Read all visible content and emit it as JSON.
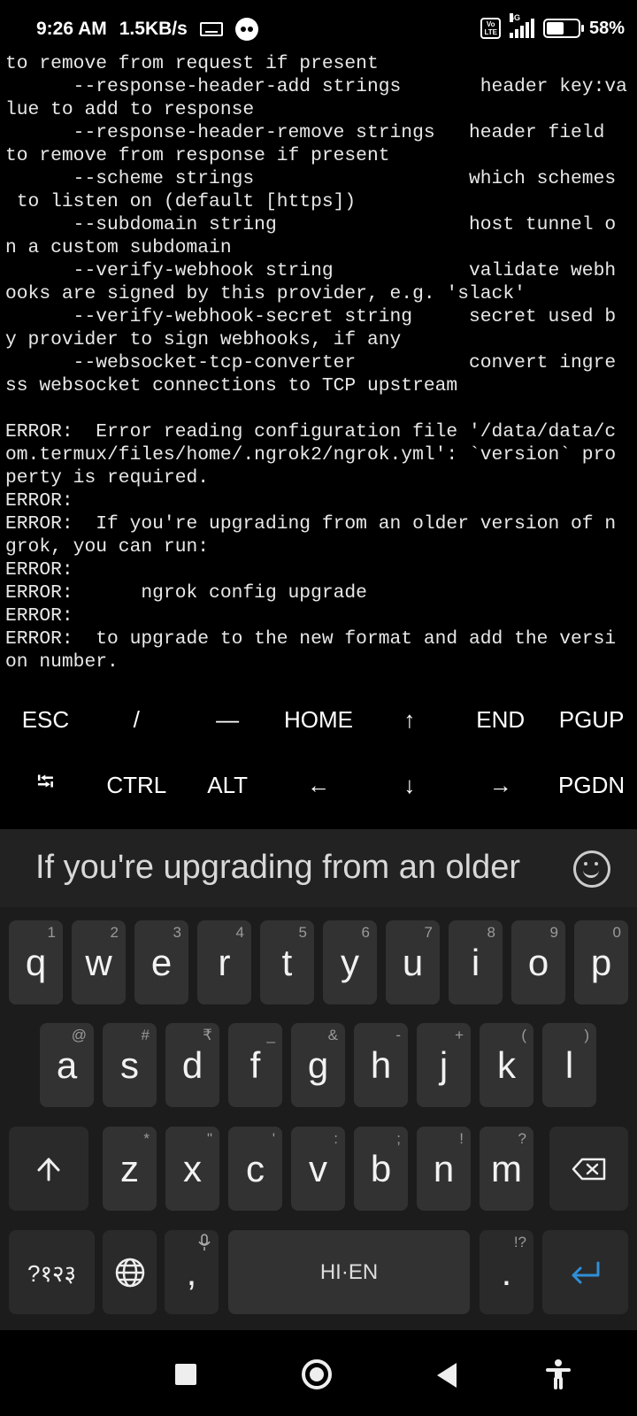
{
  "status_bar": {
    "time": "9:26 AM",
    "net_speed": "1.5KB/s",
    "volte": "Vo\nLTE",
    "network": "4G",
    "battery_percent": "58%",
    "battery_level": 0.58,
    "icons": [
      "keyboard-icon",
      "bubbles-icon",
      "volte-icon",
      "signal-icon",
      "battery-icon"
    ]
  },
  "terminal": {
    "lines": [
      "to remove from request if present",
      "      --response-header-add strings       header key:va",
      "lue to add to response",
      "      --response-header-remove strings   header field",
      "to remove from response if present",
      "      --scheme strings                   which schemes",
      " to listen on (default [https])",
      "      --subdomain string                 host tunnel o",
      "n a custom subdomain",
      "      --verify-webhook string            validate webh",
      "ooks are signed by this provider, e.g. 'slack'",
      "      --verify-webhook-secret string     secret used b",
      "y provider to sign webhooks, if any",
      "      --websocket-tcp-converter          convert ingre",
      "ss websocket connections to TCP upstream",
      "",
      "ERROR:  Error reading configuration file '/data/data/c",
      "om.termux/files/home/.ngrok2/ngrok.yml': `version` pro",
      "perty is required.",
      "ERROR:",
      "ERROR:  If you're upgrading from an older version of n",
      "grok, you can run:",
      "ERROR:",
      "ERROR:      ngrok config upgrade",
      "ERROR:",
      "ERROR:  to upgrade to the new format and add the versi",
      "on number."
    ]
  },
  "extra_keys": {
    "row1": [
      "ESC",
      "/",
      "—",
      "HOME",
      "↑",
      "END",
      "PGUP"
    ],
    "row2": [
      "⭾",
      "CTRL",
      "ALT",
      "←",
      "↓",
      "→",
      "PGDN"
    ]
  },
  "keyboard": {
    "suggestion": "If you're upgrading from an older",
    "row1": [
      {
        "k": "q",
        "h": "1"
      },
      {
        "k": "w",
        "h": "2"
      },
      {
        "k": "e",
        "h": "3"
      },
      {
        "k": "r",
        "h": "4"
      },
      {
        "k": "t",
        "h": "5"
      },
      {
        "k": "y",
        "h": "6"
      },
      {
        "k": "u",
        "h": "7"
      },
      {
        "k": "i",
        "h": "8"
      },
      {
        "k": "o",
        "h": "9"
      },
      {
        "k": "p",
        "h": "0"
      }
    ],
    "row2": [
      {
        "k": "a",
        "h": "@"
      },
      {
        "k": "s",
        "h": "#"
      },
      {
        "k": "d",
        "h": "₹"
      },
      {
        "k": "f",
        "h": "_"
      },
      {
        "k": "g",
        "h": "&"
      },
      {
        "k": "h",
        "h": "-"
      },
      {
        "k": "j",
        "h": "+"
      },
      {
        "k": "k",
        "h": "("
      },
      {
        "k": "l",
        "h": ")"
      }
    ],
    "row3": [
      {
        "k": "z",
        "h": "*"
      },
      {
        "k": "x",
        "h": "\""
      },
      {
        "k": "c",
        "h": "'"
      },
      {
        "k": "v",
        "h": ":"
      },
      {
        "k": "b",
        "h": ";"
      },
      {
        "k": "n",
        "h": "!"
      },
      {
        "k": "m",
        "h": "?"
      }
    ],
    "symbols_key": "?१२३",
    "comma_key": ",",
    "space_label": "HI·EN",
    "period_key": ".",
    "period_hint": "!?",
    "accent_color": "#2f8fd8"
  },
  "nav_bar": {
    "icons": [
      "recents-icon",
      "home-icon",
      "back-icon",
      "accessibility-icon"
    ]
  }
}
